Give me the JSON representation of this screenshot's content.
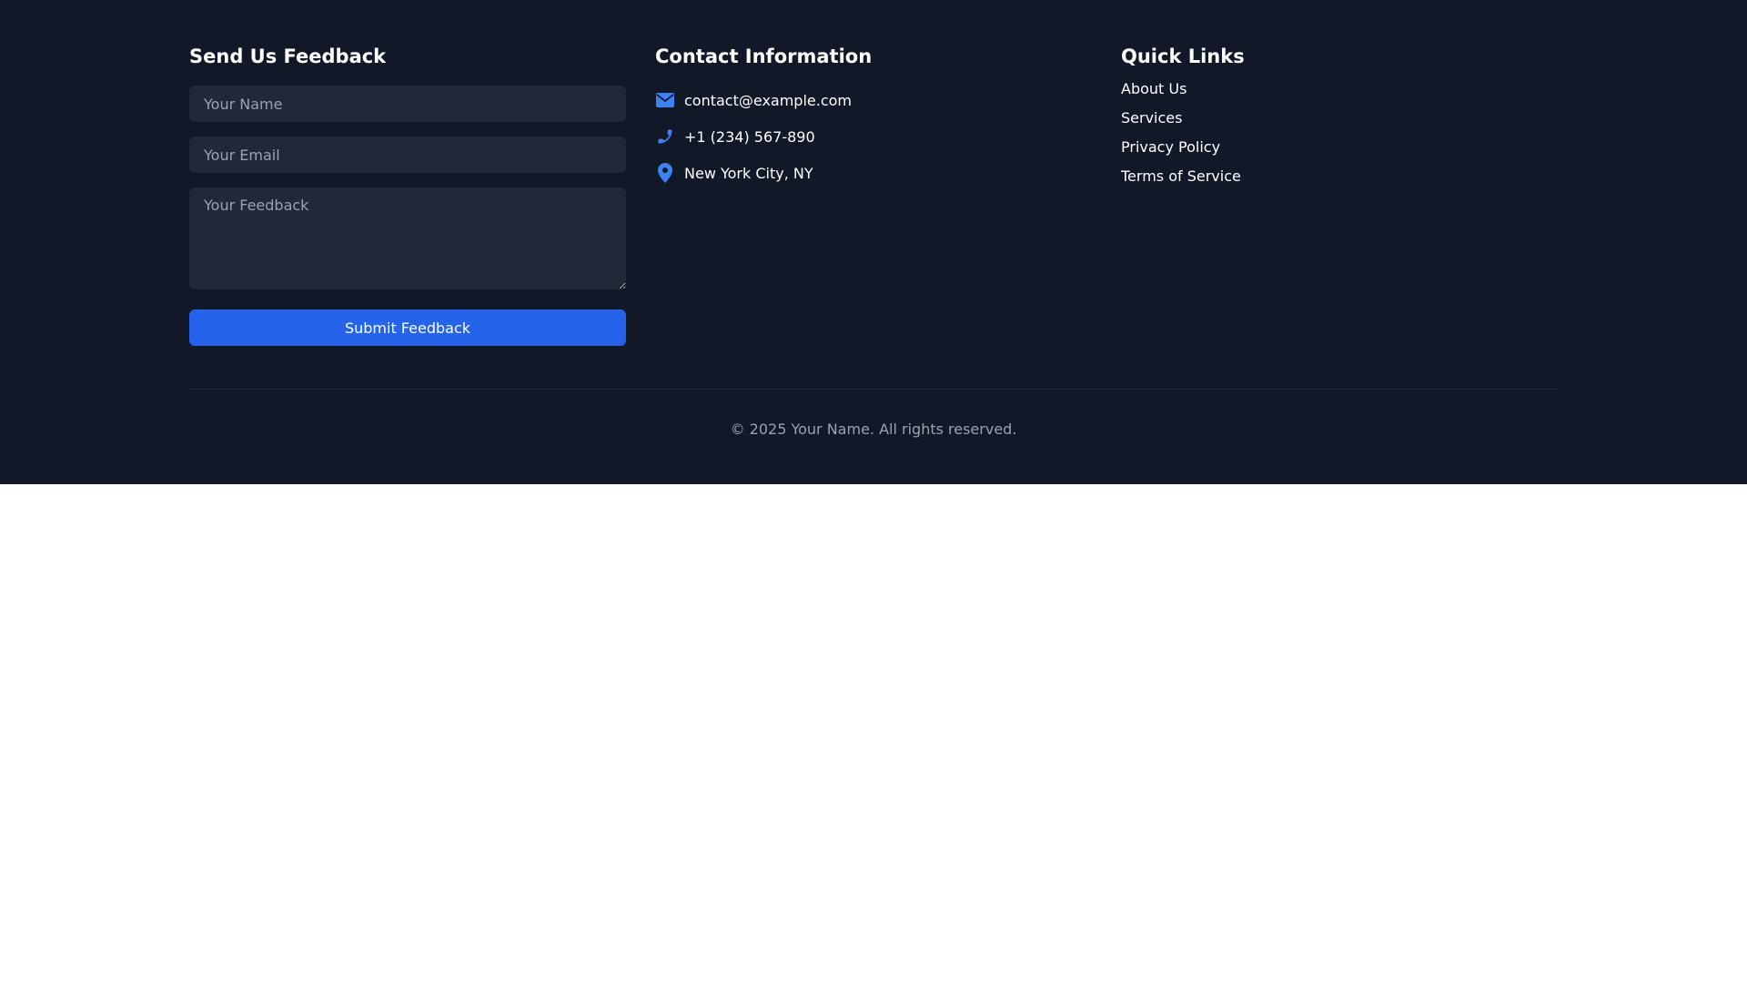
{
  "feedback": {
    "title": "Send Us Feedback",
    "name_placeholder": "Your Name",
    "email_placeholder": "Your Email",
    "feedback_placeholder": "Your Feedback",
    "submit_label": "Submit Feedback"
  },
  "contact": {
    "title": "Contact Information",
    "items": [
      {
        "icon": "envelope-icon",
        "text": "contact@example.com"
      },
      {
        "icon": "phone-icon",
        "text": "+1 (234) 567-890"
      },
      {
        "icon": "map-pin-icon",
        "text": "New York City, NY"
      }
    ]
  },
  "quick_links": {
    "title": "Quick Links",
    "items": [
      {
        "label": "About Us"
      },
      {
        "label": "Services"
      },
      {
        "label": "Privacy Policy"
      },
      {
        "label": "Terms of Service"
      }
    ]
  },
  "footer": {
    "copyright": "© 2025 Your Name. All rights reserved."
  },
  "colors": {
    "background": "#111827",
    "field_background": "#1f2937",
    "accent": "#2563eb",
    "icon": "#3b82f6",
    "muted_text": "#9ca3af"
  }
}
